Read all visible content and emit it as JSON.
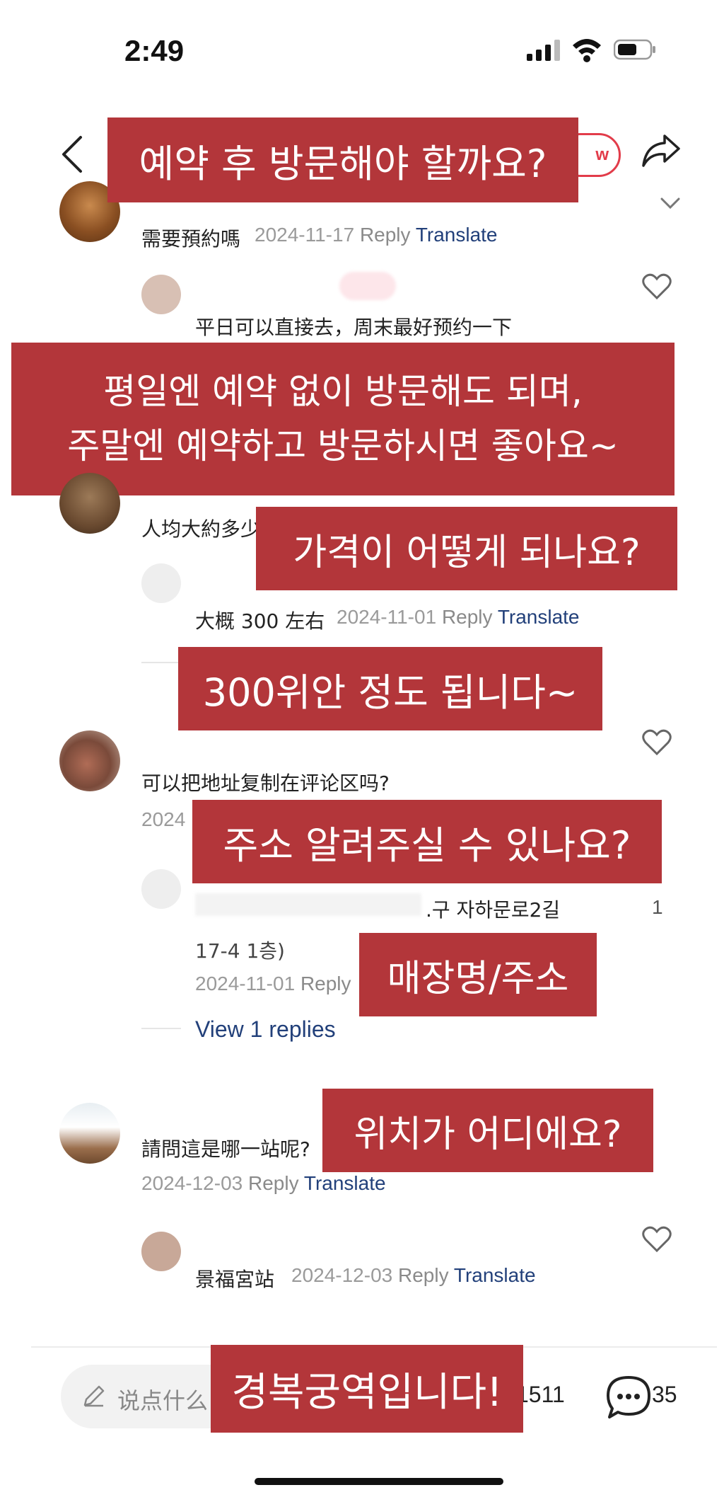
{
  "status_bar": {
    "time": "2:49"
  },
  "header": {
    "follow_label": "w"
  },
  "overlays": {
    "q1": "예약 후 방문해야 할까요?",
    "a1_line1": "평일엔 예약 없이 방문해도 되며,",
    "a1_line2": "주말엔 예약하고 방문하시면 좋아요~",
    "q2": "가격이 어떻게 되나요?",
    "a2": "300위안 정도 됩니다~",
    "q3": "주소 알려주실 수 있나요?",
    "a3": "매장명/주소",
    "q4": "위치가 어디에요?",
    "a4": "경복궁역입니다!"
  },
  "comments": [
    {
      "text": "需要預約嗎",
      "date": "2024-11-17",
      "reply": "Reply",
      "translate": "Translate"
    },
    {
      "text": "平日可以直接去，周末最好预约一下"
    },
    {
      "text": "人均大約多少"
    },
    {
      "text": "大概 300 左右",
      "date": "2024-11-01",
      "reply": "Reply",
      "translate": "Translate"
    },
    {
      "text": "可以把地址复制在评论区吗?",
      "date_partial": "2024"
    },
    {
      "text": ".구 자하문로2길",
      "line2": "17-4 1층)",
      "date": "2024-11-01",
      "reply": "Reply",
      "likes": "1"
    },
    {
      "text": "請問這是哪一站呢?",
      "date": "2024-12-03",
      "reply": "Reply",
      "translate": "Translate"
    },
    {
      "text": "景福宮站",
      "date": "2024-12-03",
      "reply": "Reply",
      "translate": "Translate"
    }
  ],
  "view_replies": "View 1 replies",
  "bottom_bar": {
    "input_placeholder": "说点什么",
    "like_count": "1511",
    "comment_count": "35"
  },
  "colors": {
    "overlay_bg": "#b3363a",
    "link": "#22407a",
    "accent": "#e23c4a"
  }
}
